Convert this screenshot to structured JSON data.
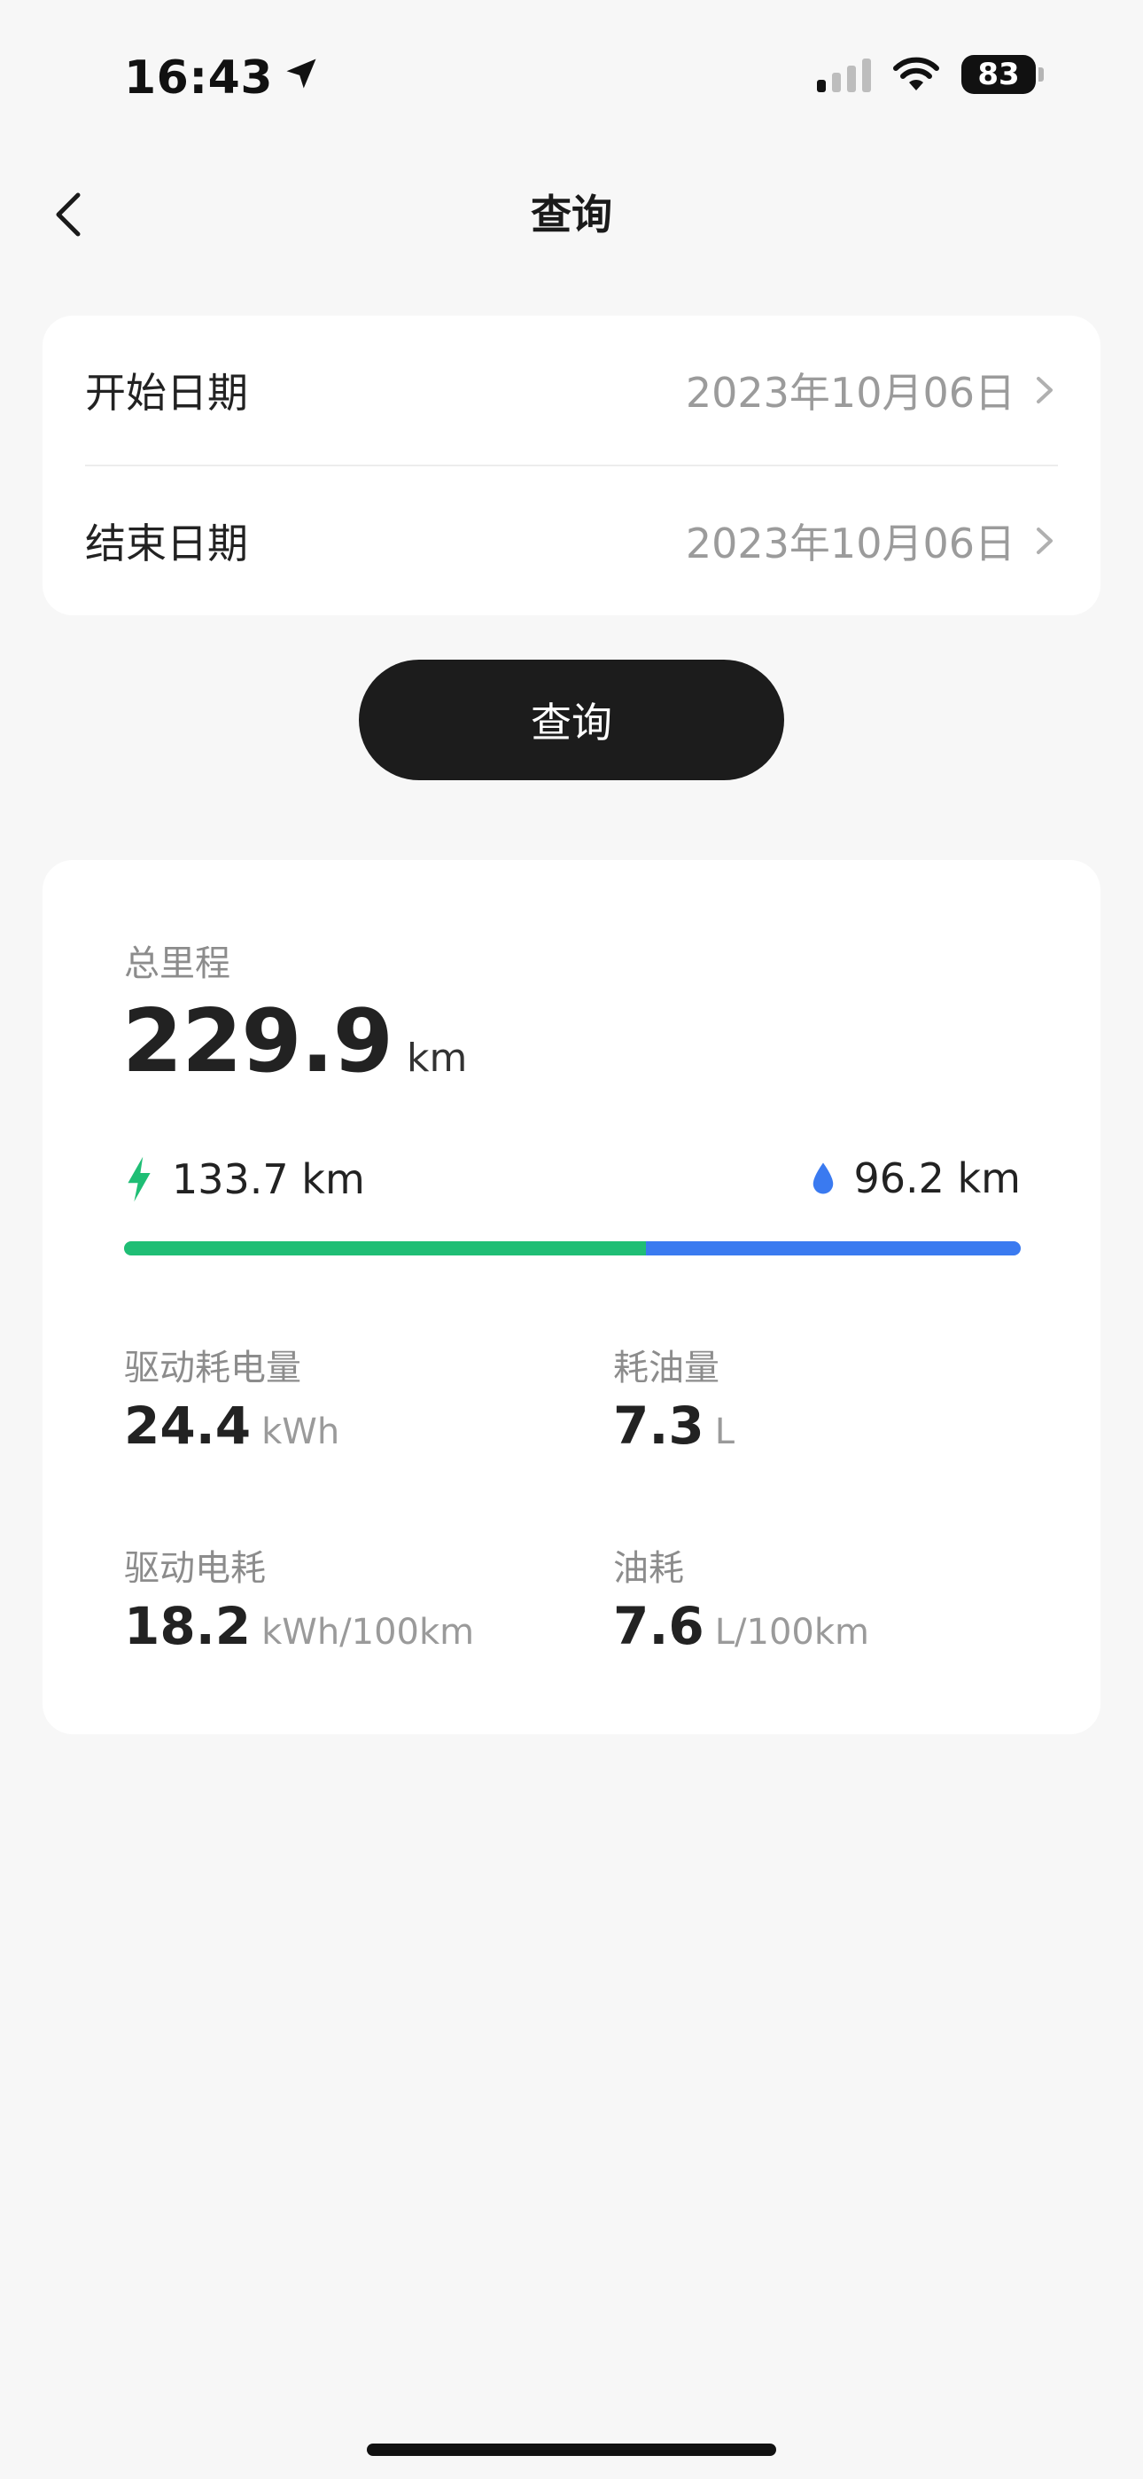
{
  "status_bar": {
    "time": "16:43",
    "battery": "83"
  },
  "nav": {
    "title": "查询"
  },
  "date_range": {
    "start_label": "开始日期",
    "start_value": "2023年10月06日",
    "end_label": "结束日期",
    "end_value": "2023年10月06日"
  },
  "query_button": "查询",
  "summary": {
    "total_label": "总里程",
    "total_value": "229.9",
    "total_unit": "km",
    "electric_distance": "133.7 km",
    "fuel_distance": "96.2 km",
    "electric_fraction": 0.5816,
    "electric_color": "#1fbe75",
    "fuel_color": "#3a7af0"
  },
  "metrics": [
    {
      "label": "驱动耗电量",
      "value": "24.4",
      "unit": "kWh"
    },
    {
      "label": "耗油量",
      "value": "7.3",
      "unit": "L"
    },
    {
      "label": "驱动电耗",
      "value": "18.2",
      "unit": "kWh/100km"
    },
    {
      "label": "油耗",
      "value": "7.6",
      "unit": "L/100km"
    }
  ]
}
